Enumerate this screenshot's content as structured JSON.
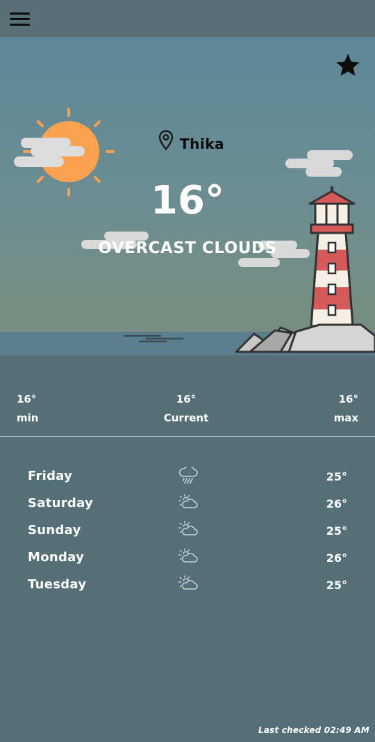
{
  "header": {
    "menu_icon": "hamburger-menu-icon"
  },
  "hero": {
    "favorite_icon": "star-icon",
    "location_icon": "map-pin-icon",
    "city": "Thika",
    "temperature": "16°",
    "description": "OVERCAST CLOUDS",
    "illustration": "lighthouse-sun-clouds-illustration"
  },
  "summary": {
    "min": {
      "value": "16°",
      "label": "min"
    },
    "current": {
      "value": "16°",
      "label": "Current"
    },
    "max": {
      "value": "16°",
      "label": "max"
    }
  },
  "forecast": [
    {
      "day": "Friday",
      "icon": "rain-cloud-icon",
      "temp": "25°"
    },
    {
      "day": "Saturday",
      "icon": "partly-cloudy-icon",
      "temp": "26°"
    },
    {
      "day": "Sunday",
      "icon": "partly-cloudy-icon",
      "temp": "25°"
    },
    {
      "day": "Monday",
      "icon": "partly-cloudy-icon",
      "temp": "26°"
    },
    {
      "day": "Tuesday",
      "icon": "partly-cloudy-icon",
      "temp": "25°"
    }
  ],
  "footer": {
    "last_checked": "Last checked 02:49 AM"
  },
  "colors": {
    "background": "#556f76",
    "topbar": "#587076",
    "sun": "#f9a14f",
    "lighthouse_red": "#d65a5a",
    "cloud": "#d9d9d9"
  }
}
